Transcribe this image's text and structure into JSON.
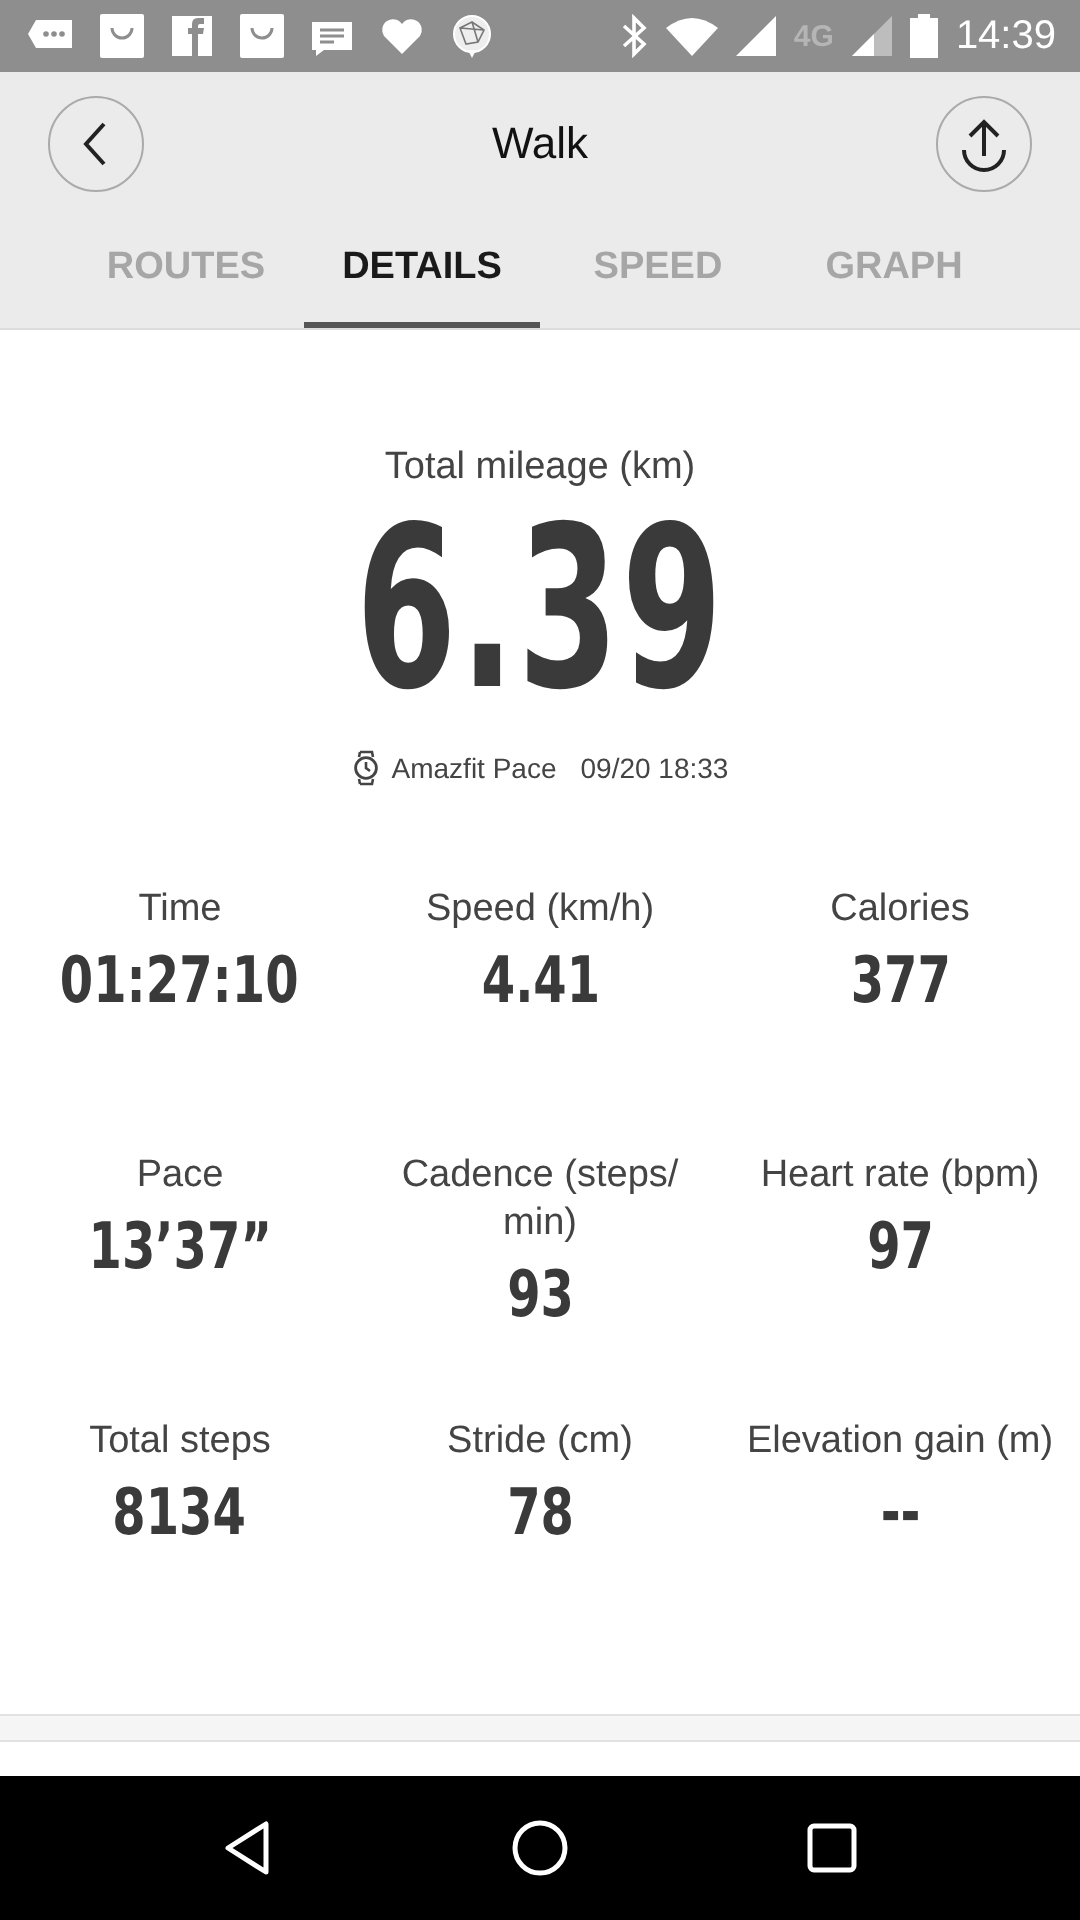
{
  "status_bar": {
    "network": "4G",
    "time": "14:39"
  },
  "header": {
    "title": "Walk"
  },
  "tabs": [
    {
      "label": "ROUTES",
      "selected": false
    },
    {
      "label": "DETAILS",
      "selected": true
    },
    {
      "label": "SPEED",
      "selected": false
    },
    {
      "label": "GRAPH",
      "selected": false
    }
  ],
  "summary": {
    "label": "Total mileage (km)",
    "value": "6.39",
    "device": "Amazfit Pace",
    "date": "09/20 18:33"
  },
  "stats": [
    {
      "label": "Time",
      "value": "01:27:10"
    },
    {
      "label": "Speed (km/h)",
      "value": "4.41"
    },
    {
      "label": "Calories",
      "value": "377"
    },
    {
      "label": "Pace",
      "value": "13’37”"
    },
    {
      "label": "Cadence (steps/ min)",
      "value": "93"
    },
    {
      "label": "Heart rate (bpm)",
      "value": "97"
    },
    {
      "label": "Total steps",
      "value": "8134"
    },
    {
      "label": "Stride (cm)",
      "value": "78"
    },
    {
      "label": "Elevation gain (m)",
      "value": "--"
    }
  ]
}
